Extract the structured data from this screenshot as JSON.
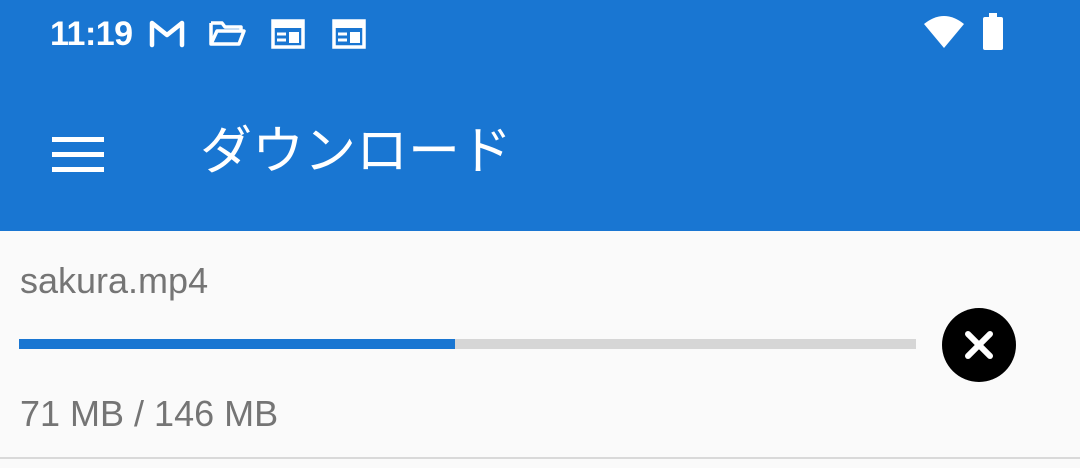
{
  "status_bar": {
    "time": "11:19",
    "icons": [
      "gmail-icon",
      "folder-icon",
      "news-icon",
      "news-icon",
      "wifi-icon",
      "battery-icon"
    ]
  },
  "app_bar": {
    "title": "ダウンロード",
    "menu_icon": "menu-icon"
  },
  "download": {
    "file_name": "sakura.mp4",
    "downloaded_mb": 71,
    "total_mb": 146,
    "size_text": "71 MB / 146 MB",
    "progress_fraction": 0.4863,
    "cancel_icon": "close-icon"
  },
  "colors": {
    "primary": "#1976d2",
    "track": "#d6d6d6",
    "text_secondary": "#757575",
    "background": "#fafafa"
  }
}
